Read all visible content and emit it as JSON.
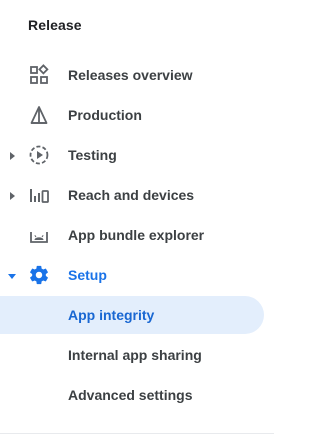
{
  "nav": {
    "section_title": "Release",
    "items": [
      {
        "label": "Releases overview"
      },
      {
        "label": "Production"
      },
      {
        "label": "Testing"
      },
      {
        "label": "Reach and devices"
      },
      {
        "label": "App bundle explorer"
      },
      {
        "label": "Setup"
      }
    ],
    "setup_children": [
      {
        "label": "App integrity"
      },
      {
        "label": "Internal app sharing"
      },
      {
        "label": "Advanced settings"
      }
    ]
  },
  "colors": {
    "accent": "#1a73e8",
    "active_bg": "#e3eefc",
    "text": "#3c4043",
    "icon": "#5f6368"
  }
}
